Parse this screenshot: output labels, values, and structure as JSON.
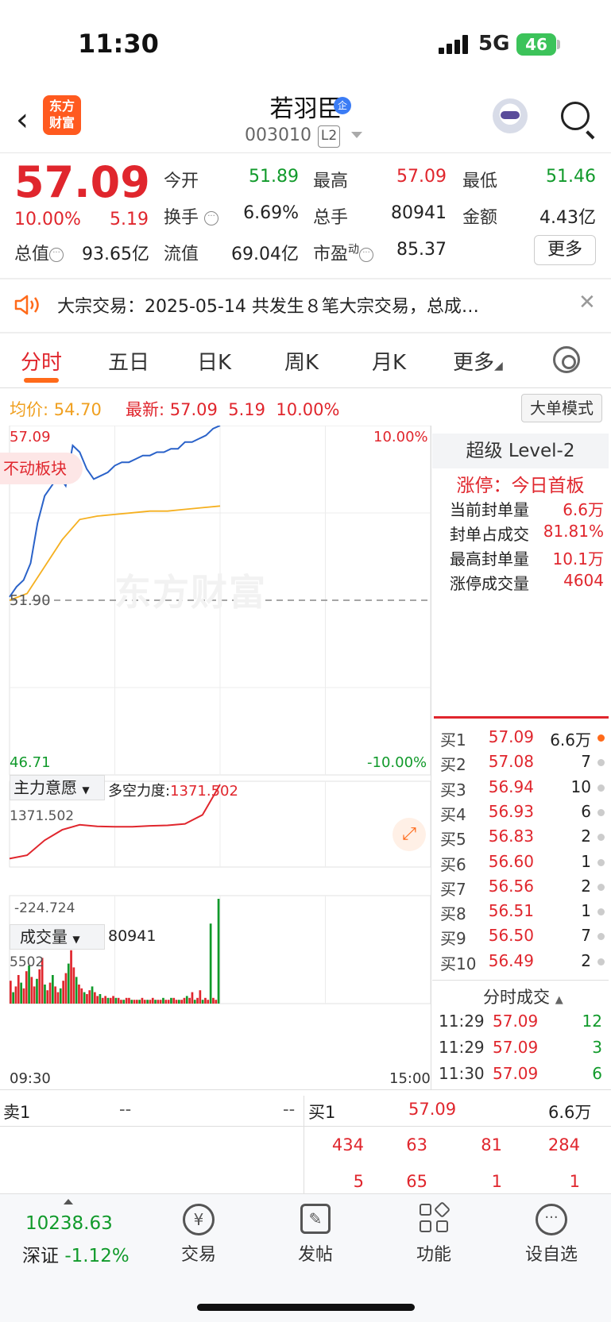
{
  "status_bar": {
    "time": "11:30",
    "network": "5G",
    "battery": "46"
  },
  "header": {
    "app_logo": "东方\n财富",
    "stock_name": "若羽臣",
    "verified_badge": "企",
    "stock_code": "003010",
    "level_badge": "L2"
  },
  "quote": {
    "price": "57.09",
    "change_pct": "10.00%",
    "change": "5.19",
    "open_label": "今开",
    "open": "51.89",
    "high_label": "最高",
    "high": "57.09",
    "low_label": "最低",
    "low": "51.46",
    "turnover_label": "换手",
    "turnover": "6.69%",
    "volume_label": "总手",
    "volume": "80941",
    "amount_label": "金额",
    "amount": "4.43亿",
    "mcap_label": "总值",
    "mcap": "93.65亿",
    "float_label": "流值",
    "float": "69.04亿",
    "pe_label": "市盈",
    "pe_sup": "动",
    "pe": "85.37",
    "more_button": "更多"
  },
  "notice": {
    "text": "大宗交易：2025-05-14 共发生８笔大宗交易，总成…"
  },
  "tabs": [
    "分时",
    "五日",
    "日K",
    "周K",
    "月K",
    "更多"
  ],
  "chart_header": {
    "avg_label": "均价:",
    "avg": "54.70",
    "latest_label": "最新:",
    "latest": "57.09",
    "latest_chg": "5.19",
    "latest_pct": "10.00%",
    "big_order_mode": "大单模式"
  },
  "chart_labels": {
    "top_price": "57.09",
    "top_pct": "10.00%",
    "base_price": "51.90",
    "bottom_price": "46.71",
    "bottom_pct": "-10.00%",
    "sector_tag": "不动板块",
    "watermark": "东方财富",
    "indicator_title": "主力意愿",
    "indicator_sub_label": "多空力度:",
    "indicator_sub_value": "1371.502",
    "ind_top": "1371.502",
    "ind_bottom": "-224.724",
    "vol_title": "成交量",
    "vol_value": "80941",
    "vol_top": "5502",
    "time_start": "09:30",
    "time_end": "15:00"
  },
  "chart_data": {
    "type": "line",
    "title": "",
    "ylim": [
      46.71,
      57.09
    ],
    "series": [
      {
        "name": "最新",
        "x": [
          0,
          4,
          8,
          12,
          16,
          20,
          24,
          28,
          32,
          36,
          40,
          44,
          48,
          52,
          56,
          60,
          64,
          68,
          72,
          76,
          80,
          84,
          88,
          92,
          96,
          100,
          104,
          108,
          112,
          116,
          120
        ],
        "y": [
          52.0,
          52.3,
          52.5,
          53.0,
          54.2,
          55.0,
          55.3,
          55.6,
          55.3,
          56.5,
          56.3,
          55.8,
          55.5,
          55.6,
          55.7,
          55.9,
          56.0,
          56.0,
          56.1,
          56.2,
          56.2,
          56.3,
          56.3,
          56.4,
          56.4,
          56.6,
          56.6,
          56.7,
          56.8,
          57.0,
          57.09
        ]
      },
      {
        "name": "均价",
        "x": [
          0,
          10,
          20,
          30,
          40,
          50,
          60,
          70,
          80,
          90,
          100,
          110,
          120
        ],
        "y": [
          51.9,
          52.1,
          52.9,
          53.7,
          54.3,
          54.4,
          54.45,
          54.5,
          54.55,
          54.55,
          54.6,
          54.65,
          54.7
        ]
      }
    ],
    "indicator": {
      "name": "主力意愿",
      "ylim": [
        -224.724,
        1371.502
      ],
      "x": [
        0,
        10,
        20,
        30,
        40,
        50,
        60,
        70,
        80,
        90,
        100,
        110,
        120
      ],
      "y": [
        -120,
        -50,
        250,
        460,
        560,
        530,
        520,
        520,
        540,
        550,
        580,
        760,
        1371.502
      ]
    },
    "volume": {
      "name": "成交量",
      "ymax": 5502,
      "values": [
        1200,
        600,
        900,
        1500,
        1100,
        800,
        1700,
        2000,
        1400,
        900,
        1300,
        1800,
        2400,
        1000,
        700,
        1100,
        1500,
        900,
        600,
        800,
        1200,
        1600,
        2100,
        2800,
        1900,
        1400,
        1000,
        800,
        600,
        500,
        700,
        900,
        600,
        400,
        500,
        300,
        400,
        300,
        300,
        400,
        300,
        300,
        200,
        200,
        300,
        300,
        200,
        200,
        200,
        200,
        300,
        200,
        200,
        200,
        300,
        200,
        200,
        200,
        300,
        200,
        200,
        300,
        300,
        200,
        200,
        200,
        300,
        400,
        300,
        600,
        200,
        300,
        700,
        200,
        300,
        200,
        4200,
        300,
        200,
        5502
      ]
    }
  },
  "level2": {
    "title": "超级 Level-2",
    "limit_status": "涨停：今日首板",
    "rows": [
      {
        "label": "当前封单量",
        "value": "6.6万"
      },
      {
        "label": "封单占成交",
        "value": "81.81%"
      },
      {
        "label": "最高封单量",
        "value": "10.1万"
      },
      {
        "label": "涨停成交量",
        "value": "4604"
      }
    ],
    "bids": [
      {
        "label": "买1",
        "price": "57.09",
        "qty": "6.6万"
      },
      {
        "label": "买2",
        "price": "57.08",
        "qty": "7"
      },
      {
        "label": "买3",
        "price": "56.94",
        "qty": "10"
      },
      {
        "label": "买4",
        "price": "56.93",
        "qty": "6"
      },
      {
        "label": "买5",
        "price": "56.83",
        "qty": "2"
      },
      {
        "label": "买6",
        "price": "56.60",
        "qty": "1"
      },
      {
        "label": "买7",
        "price": "56.56",
        "qty": "2"
      },
      {
        "label": "买8",
        "price": "56.51",
        "qty": "1"
      },
      {
        "label": "买9",
        "price": "56.50",
        "qty": "7"
      },
      {
        "label": "买10",
        "price": "56.49",
        "qty": "2"
      }
    ],
    "ticks_title": "分时成交",
    "ticks": [
      {
        "time": "11:29",
        "price": "57.09",
        "qty": "12"
      },
      {
        "time": "11:29",
        "price": "57.09",
        "qty": "3"
      },
      {
        "time": "11:30",
        "price": "57.09",
        "qty": "6"
      }
    ]
  },
  "order_book": {
    "sell_label": "卖1",
    "sell_price": "--",
    "sell_qty": "--",
    "buy_label": "买1",
    "buy_price": "57.09",
    "buy_qty": "6.6万",
    "queue_row1": [
      "434",
      "63",
      "81",
      "284"
    ],
    "queue_row2": [
      "5",
      "65",
      "1",
      "1"
    ]
  },
  "bottom_nav": {
    "index_value": "10238.63",
    "index_name": "深证",
    "index_change": "-1.12%",
    "items": [
      "交易",
      "发帖",
      "功能",
      "设自选"
    ]
  }
}
